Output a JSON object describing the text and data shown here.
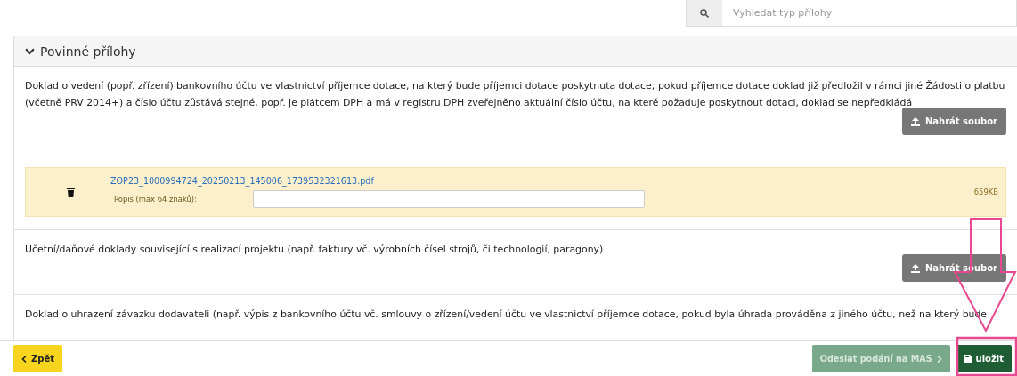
{
  "search": {
    "placeholder": "Vyhledat typ přílohy"
  },
  "panel": {
    "title": "Povinné přílohy",
    "expanded": true
  },
  "sections": [
    {
      "description": "Doklad o vedení (popř. zřízení) bankovního účtu ve vlastnictví příjemce dotace, na který bude příjemci dotace poskytnuta dotace; pokud příjemce dotace doklad již předložil v rámci jiné Žádosti o platbu (včetně PRV 2014+) a číslo účtu zůstává stejné, popř. je plátcem DPH a má v registru DPH zveřejněno aktuální číslo účtu, na které požaduje poskytnout dotaci, doklad se nepředkládá",
      "upload_label": "Nahrát soubor",
      "files": [
        {
          "name": "ZOP23_1000994724_20250213_145006_1739532321613.pdf",
          "note_label": "Popis (max 64 znaků):",
          "size": "659KB"
        }
      ]
    },
    {
      "description": "Účetní/daňové doklady související s realizací projektu (např. faktury vč. výrobních čísel strojů, či technologií, paragony)",
      "upload_label": "Nahrát soubor"
    },
    {
      "description": "Doklad o uhrazení závazku dodavateli (např. výpis z bankovního účtu vč. smlouvy o zřízení/vedení účtu ve vlastnictví příjemce dotace, pokud byla úhrada prováděna z jiného účtu, než na který bude"
    }
  ],
  "footer": {
    "back": "Zpět",
    "submit": {
      "label": "Odeslat podání na MAS",
      "disabled": true
    },
    "save": "uložit"
  }
}
